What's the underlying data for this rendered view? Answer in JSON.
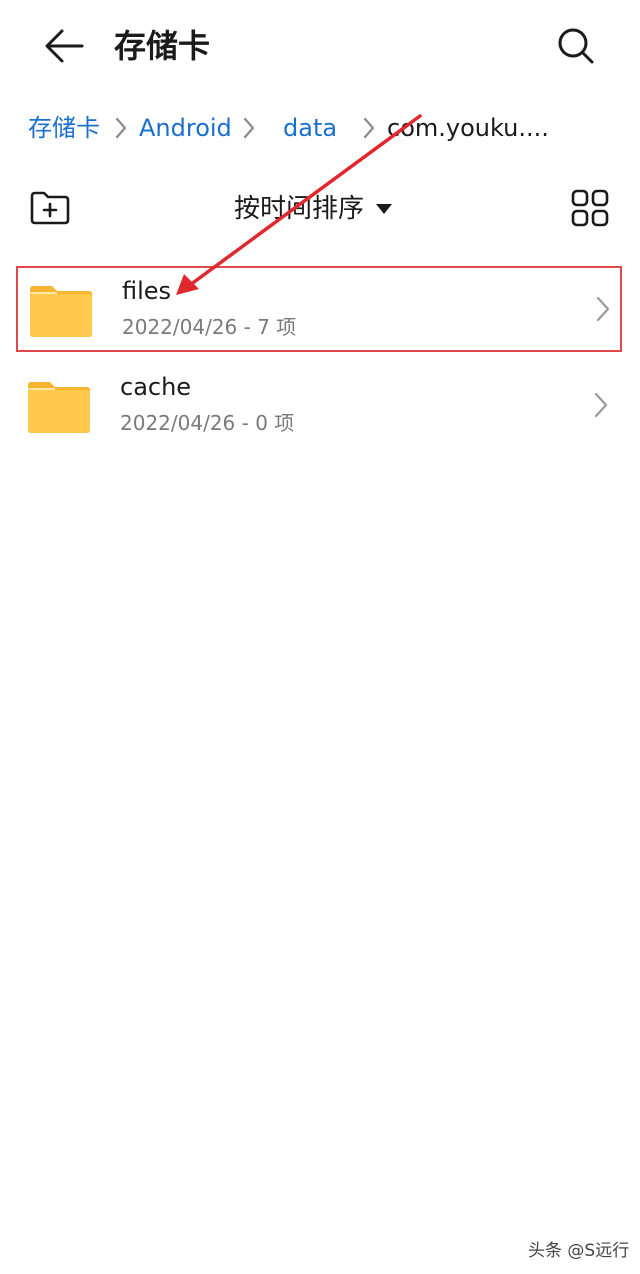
{
  "header": {
    "title": "存储卡",
    "back_icon": "arrow-left-icon",
    "search_icon": "search-icon"
  },
  "breadcrumb": {
    "items": [
      {
        "label": "存储卡"
      },
      {
        "label": "Android"
      },
      {
        "label": "data"
      },
      {
        "label": "com.youku...."
      }
    ]
  },
  "toolbar": {
    "new_folder_icon": "new-folder-icon",
    "sort_label": "按时间排序",
    "grid_view_icon": "grid-view-icon"
  },
  "files": [
    {
      "name": "files",
      "meta": "2022/04/26 - 7 项",
      "highlighted": true
    },
    {
      "name": "cache",
      "meta": "2022/04/26 - 0 项",
      "highlighted": false
    }
  ],
  "colors": {
    "accent": "#1a6fd1",
    "folder": "#ffc94d",
    "annotation": "#e0282e"
  },
  "watermark": "头条 @S远行"
}
